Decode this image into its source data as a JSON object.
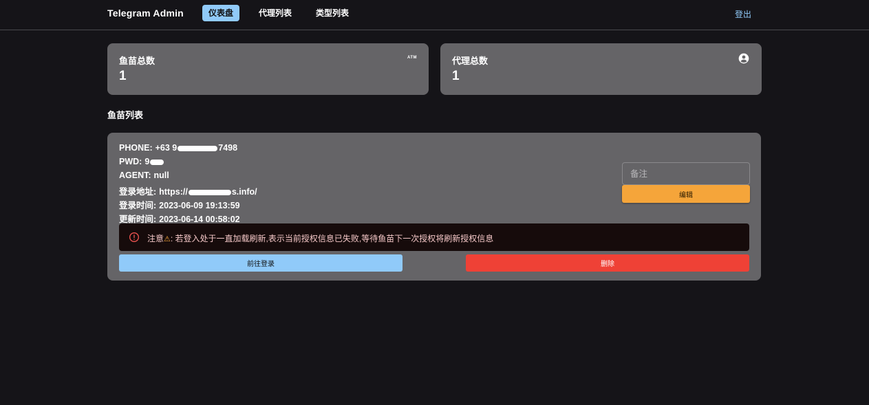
{
  "header": {
    "brand": "Telegram Admin",
    "nav": [
      {
        "label": "仪表盘",
        "active": true
      },
      {
        "label": "代理列表",
        "active": false
      },
      {
        "label": "类型列表",
        "active": false
      }
    ],
    "logout": "登出"
  },
  "stats": [
    {
      "label": "鱼苗总数",
      "value": "1",
      "icon": "atm-icon",
      "icon_text": "ATM"
    },
    {
      "label": "代理总数",
      "value": "1",
      "icon": "account-circle-icon"
    }
  ],
  "section_title": "鱼苗列表",
  "item": {
    "phone_label": "PHONE:",
    "phone_value_start": "+63 9",
    "phone_value_end": "7498",
    "pwd_label": "PWD:",
    "pwd_value_start": "9",
    "agent_label": "AGENT:",
    "agent_value": "null",
    "login_url_label": "登录地址:",
    "login_url_start": "https://",
    "login_url_end": "s.info/",
    "login_time_label": "登录时间:",
    "login_time_value": "2023-06-09 19:13:59",
    "update_time_label": "更新时间:",
    "update_time_value": "2023-06-14 00:58:02",
    "note_placeholder": "备注",
    "note_value": "",
    "edit_label": "编辑",
    "alert_prefix": "注意",
    "alert_text": ": 若登入处于一直加载刷新,表示当前授权信息已失败,等待鱼苗下一次授权将刷新授权信息",
    "goto_login_label": "前往登录",
    "delete_label": "删除"
  },
  "colors": {
    "background": "#151418",
    "card": "#656467",
    "primary": "#90caf9",
    "warning": "#f5a53a",
    "danger": "#ef4136",
    "alert_bg": "#160b0b"
  }
}
